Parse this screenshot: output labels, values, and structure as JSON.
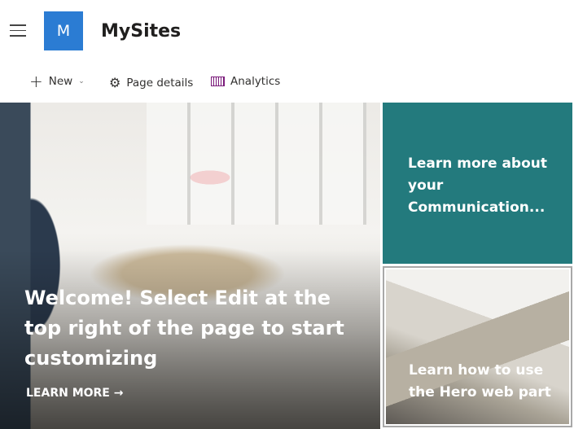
{
  "header": {
    "logo_letter": "M",
    "site_title": "MySites"
  },
  "commands": {
    "new": "New",
    "page_details": "Page details",
    "analytics": "Analytics"
  },
  "hero": {
    "main": {
      "title": "Welcome! Select Edit at the top right of the page to start customizing",
      "link": "LEARN MORE"
    },
    "tiles": [
      {
        "title": "Learn more about your Communication...",
        "color": "#237a7d"
      },
      {
        "title": "Learn how to use the Hero web part"
      }
    ]
  }
}
